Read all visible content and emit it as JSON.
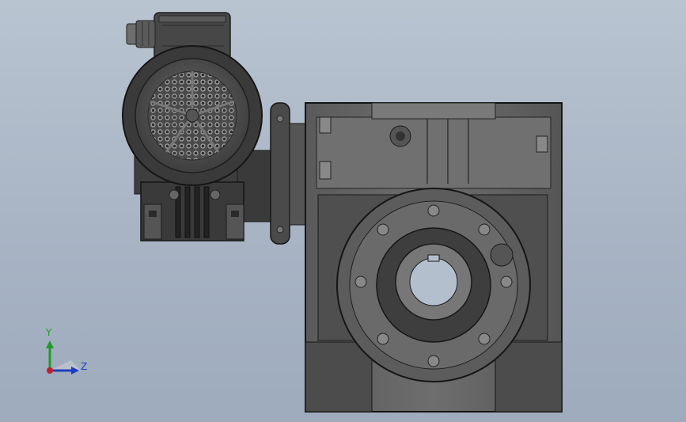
{
  "viewport": {
    "background_top": "#b9c4d1",
    "background_bottom": "#9eabbc"
  },
  "model": {
    "parts": [
      {
        "name": "terminal-box"
      },
      {
        "name": "cable-gland"
      },
      {
        "name": "motor-fan-cover"
      },
      {
        "name": "motor-body"
      },
      {
        "name": "motor-foot-bracket"
      },
      {
        "name": "adapter-flange"
      },
      {
        "name": "gearbox-housing"
      },
      {
        "name": "output-flange"
      },
      {
        "name": "output-shaft-bore"
      }
    ]
  },
  "triad": {
    "y_label": "Y",
    "z_label": "Z",
    "y_color": "#1f9a2a",
    "z_color": "#1d3fbf",
    "x_color": "#c0202a"
  }
}
